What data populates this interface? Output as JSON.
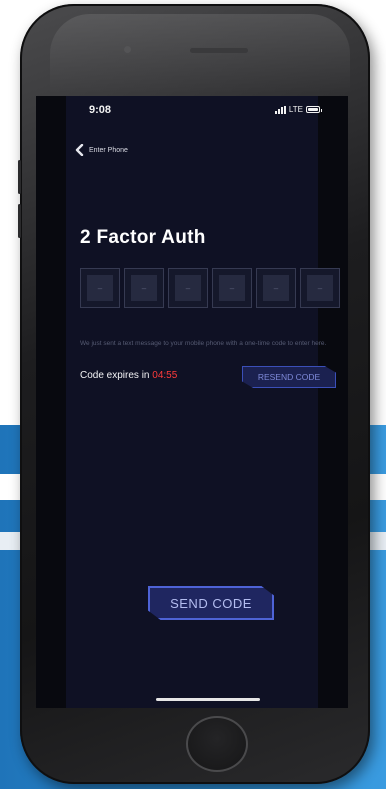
{
  "status_bar": {
    "time": "9:08",
    "network": "LTE"
  },
  "nav": {
    "back_label": "Enter Phone"
  },
  "title": "2 Factor Auth",
  "code_inputs": {
    "placeholder": "–",
    "count": 6
  },
  "info_text": "We just sent a text message to your mobile phone with a one-time code to enter here.",
  "expiry": {
    "label": "Code expires in",
    "countdown": "04:55"
  },
  "buttons": {
    "resend_label": "RESEND CODE",
    "send_label": "SEND CODE"
  },
  "colors": {
    "background": "#0f1124",
    "accent": "#4e63d6",
    "countdown": "#ff3b3b",
    "backdrop_blue": "#2b8bd0"
  }
}
